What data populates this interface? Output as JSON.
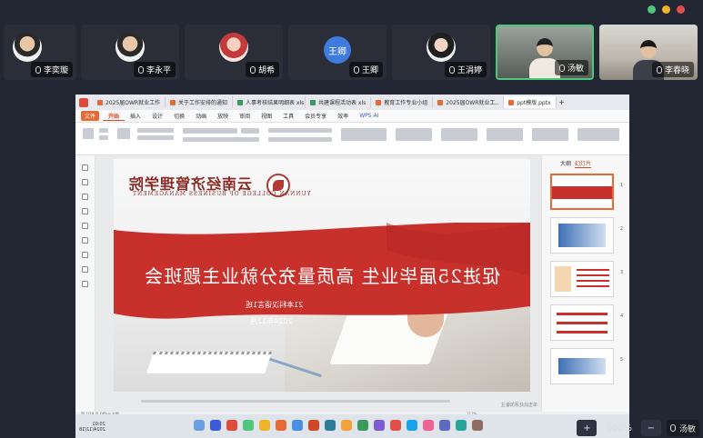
{
  "window_controls": {
    "colors": [
      "#4ec77a",
      "#f0b429",
      "#e0504a"
    ]
  },
  "participants": [
    {
      "name": "李奕璇",
      "type": "avatar"
    },
    {
      "name": "李永平",
      "type": "avatar"
    },
    {
      "name": "胡希",
      "type": "avatar"
    },
    {
      "name": "王卿",
      "type": "initial-avatar",
      "initial": "王卿"
    },
    {
      "name": "王涓婷",
      "type": "avatar"
    },
    {
      "name": "汤敏",
      "type": "video",
      "active": true
    },
    {
      "name": "李春晓",
      "type": "video"
    }
  ],
  "app": {
    "tabs": [
      "2025届OWR就业工作",
      "关于工作安排的通知",
      "人事考核结果明细表 xls",
      "共建课程活动表 xls",
      "教育工作专业小组",
      "2025届OWR就业工..",
      "ppt模版.pptx"
    ],
    "tab_add": "+",
    "menu": [
      "三 文件",
      "开始",
      "插入",
      "设计",
      "切换",
      "动画",
      "放映",
      "审阅",
      "视图",
      "工具",
      "会员专享",
      "效率"
    ],
    "menu_active": "开始",
    "file_label": "文件",
    "wps_ai": "WPS AI",
    "thumb_pane_labels": [
      "大纲",
      "幻灯片"
    ],
    "thumb_numbers": [
      "1",
      "2",
      "3",
      "4",
      "5"
    ],
    "status_text": "第 1/18 页  Office 主题",
    "canvas_note": "单击此处添加备注",
    "zoom": "112%"
  },
  "slide": {
    "logo_cn": "云南经济管理学院",
    "logo_en": "YUNNAN COLLEGE OF BUSINESS MANAGEMENT",
    "title": "促进25届毕业生 高质量充分就业主题班会",
    "class_name": "21本科汉语言1班",
    "date": "2024年12月",
    "banner_color": "#c8302c"
  },
  "taskbar": {
    "time": "20:01",
    "date": "2024/12/18"
  },
  "bottom": {
    "zoom_label": "100%",
    "presenter_name": "汤敏",
    "minus": "−",
    "plus": "+"
  }
}
